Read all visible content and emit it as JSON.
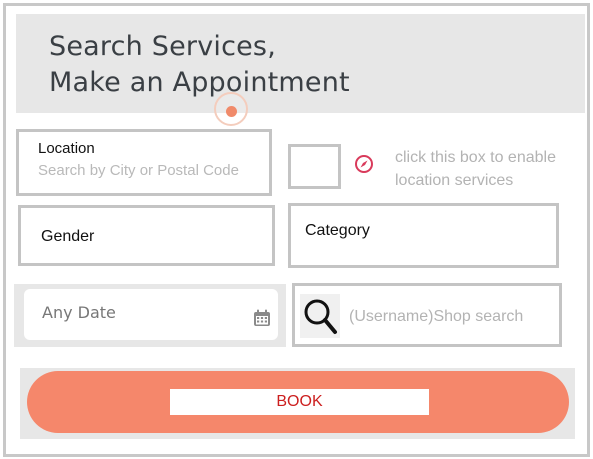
{
  "header": {
    "title": "Search Services,\nMake an Appointment"
  },
  "location": {
    "label": "Location",
    "placeholder": "Search by City or Postal Code"
  },
  "location_services": {
    "hint": "click this box to enable location services",
    "icon": "compass-icon"
  },
  "filters": {
    "gender_label": "Gender",
    "category_label": "Category"
  },
  "date": {
    "label": "Any Date",
    "icon": "calendar-icon"
  },
  "shop_search": {
    "placeholder": "(Username)Shop search",
    "icon": "search-icon"
  },
  "book": {
    "label": "BOOK"
  },
  "colors": {
    "accent": "#f5876b",
    "header_bg": "#e7e7e7",
    "book_text": "#cc1f1f",
    "compass": "#d93a5b"
  }
}
